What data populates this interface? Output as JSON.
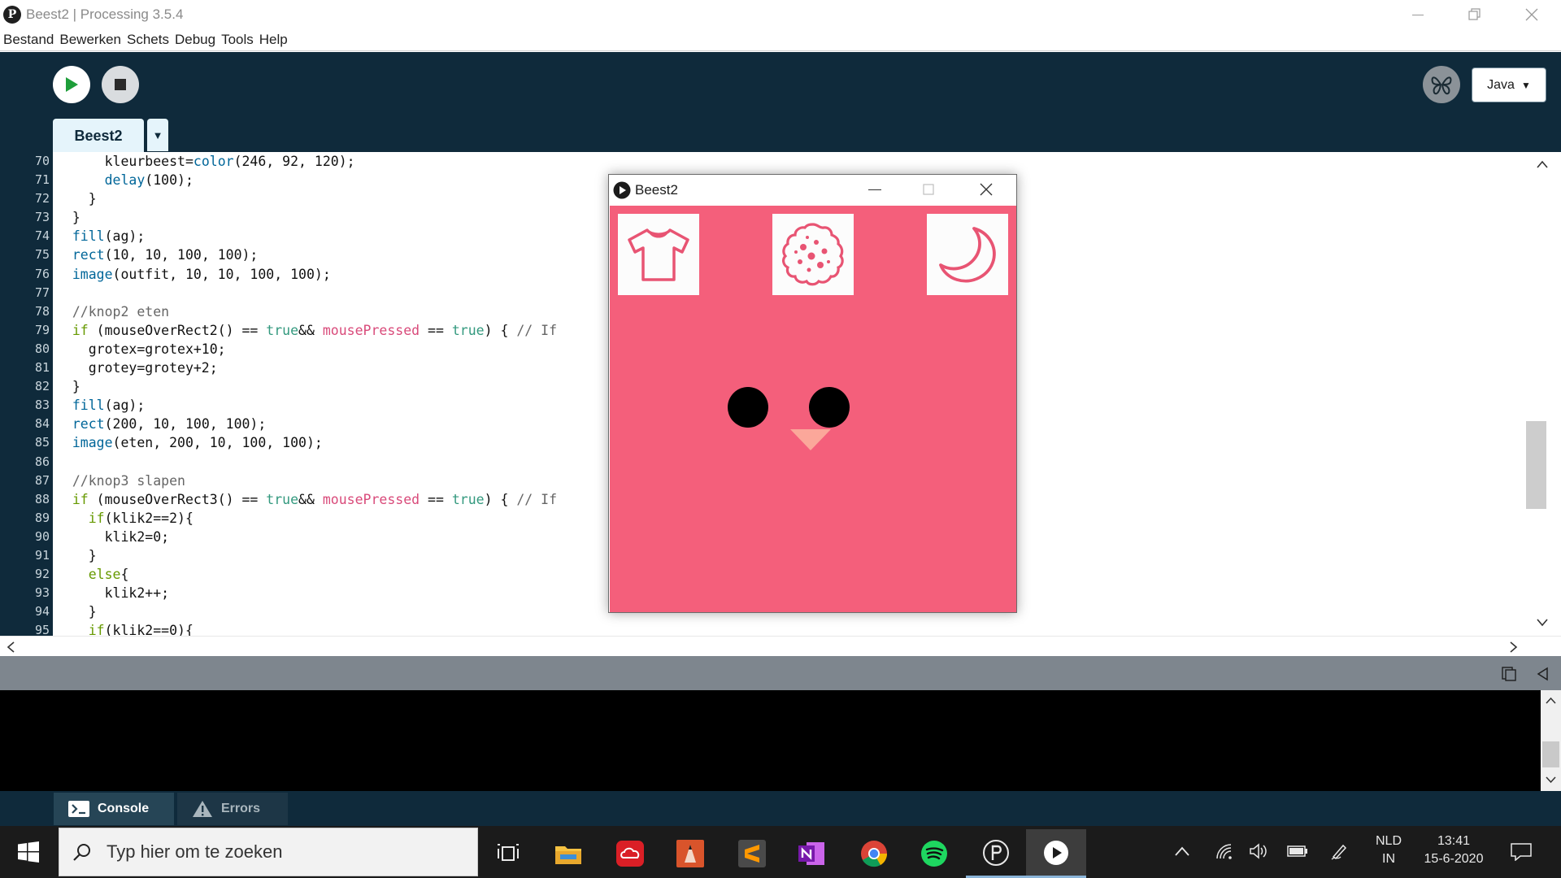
{
  "window": {
    "title": "Beest2 | Processing 3.5.4",
    "logo_glyph": "P"
  },
  "menu": [
    "Bestand",
    "Bewerken",
    "Schets",
    "Debug",
    "Tools",
    "Help"
  ],
  "toolbar": {
    "mode_label": "Java",
    "mode_caret": "▼"
  },
  "tabs": [
    {
      "label": "Beest2",
      "active": true
    }
  ],
  "tab_menu_glyph": "▼",
  "editor": {
    "line_numbers": [
      "70",
      "71",
      "72",
      "73",
      "74",
      "75",
      "76",
      "77",
      "78",
      "79",
      "80",
      "81",
      "82",
      "83",
      "84",
      "85",
      "86",
      "87",
      "88",
      "89",
      "90",
      "91",
      "92",
      "93",
      "94",
      "95"
    ]
  },
  "sketch_window": {
    "title": "Beest2",
    "canvas_color": "#f45f7b",
    "icon_color": "#e85473",
    "beak_color": "#fba79a",
    "buttons": [
      "shirt-icon",
      "cookie-icon",
      "moon-icon"
    ]
  },
  "bottom_tabs": {
    "console_label": "Console",
    "errors_label": "Errors"
  },
  "taskbar": {
    "search_placeholder": "Typ hier om te zoeken",
    "language_top": "NLD",
    "language_bottom": "IN",
    "time": "13:41",
    "date": "15-6-2020"
  },
  "colors": {
    "toolbar_bg": "#0f2a3b",
    "tab_bg": "#e5f4fb",
    "play_green": "#1e9e3a",
    "taskbar_bg": "#1b1b1b"
  }
}
